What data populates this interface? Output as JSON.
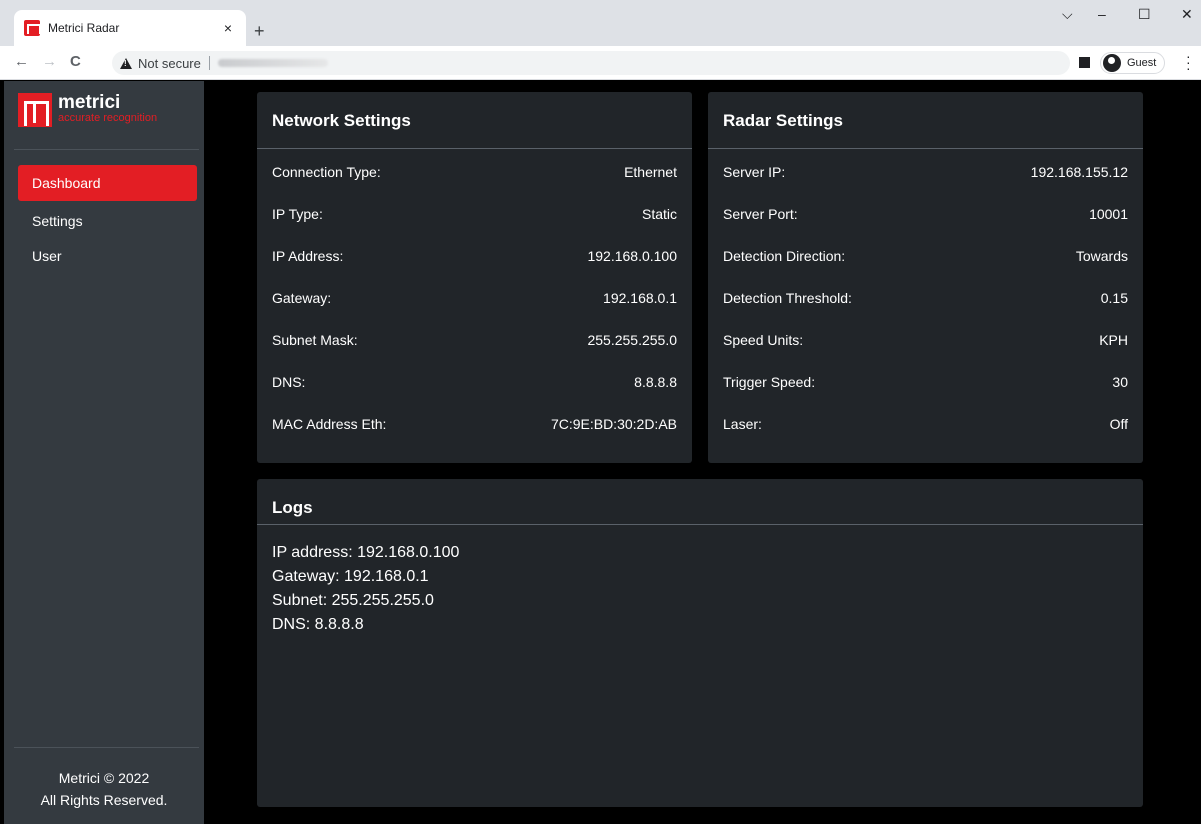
{
  "browser": {
    "tab_title": "Metrici Radar",
    "tab_close": "×",
    "new_tab": "+",
    "security_label": "Not secure",
    "profile_label": "Guest",
    "window_controls": {
      "dropdown": "⌵",
      "minimize": "–",
      "maximize": "☐",
      "close": "✕"
    },
    "nav": {
      "back": "←",
      "forward": "→",
      "reload": "C"
    }
  },
  "sidebar": {
    "brand_name": "metrici",
    "brand_tagline": "accurate recognition",
    "items": [
      {
        "label": "Dashboard",
        "active": true
      },
      {
        "label": "Settings",
        "active": false
      },
      {
        "label": "User",
        "active": false
      }
    ],
    "footer_line1": "Metrici © 2022",
    "footer_line2": "All Rights Reserved."
  },
  "network": {
    "title": "Network Settings",
    "rows": [
      {
        "label": "Connection Type:",
        "value": "Ethernet"
      },
      {
        "label": "IP Type:",
        "value": "Static"
      },
      {
        "label": "IP Address:",
        "value": "192.168.0.100"
      },
      {
        "label": "Gateway:",
        "value": "192.168.0.1"
      },
      {
        "label": "Subnet Mask:",
        "value": "255.255.255.0"
      },
      {
        "label": "DNS:",
        "value": "8.8.8.8"
      },
      {
        "label": "MAC Address Eth:",
        "value": "7C:9E:BD:30:2D:AB"
      }
    ]
  },
  "radar": {
    "title": "Radar Settings",
    "rows": [
      {
        "label": "Server IP:",
        "value": "192.168.155.12"
      },
      {
        "label": "Server Port:",
        "value": "10001"
      },
      {
        "label": "Detection Direction:",
        "value": "Towards"
      },
      {
        "label": "Detection Threshold:",
        "value": "0.15"
      },
      {
        "label": "Speed Units:",
        "value": "KPH"
      },
      {
        "label": "Trigger Speed:",
        "value": "30"
      },
      {
        "label": "Laser:",
        "value": "Off"
      }
    ]
  },
  "logs": {
    "title": "Logs",
    "lines": [
      "IP address: 192.168.0.100",
      "Gateway: 192.168.0.1",
      "Subnet: 255.255.255.0",
      "DNS: 8.8.8.8"
    ]
  },
  "colors": {
    "accent": "#e31e24",
    "sidebar_bg": "#343a40",
    "card_bg": "#212529",
    "page_bg": "#000000"
  }
}
